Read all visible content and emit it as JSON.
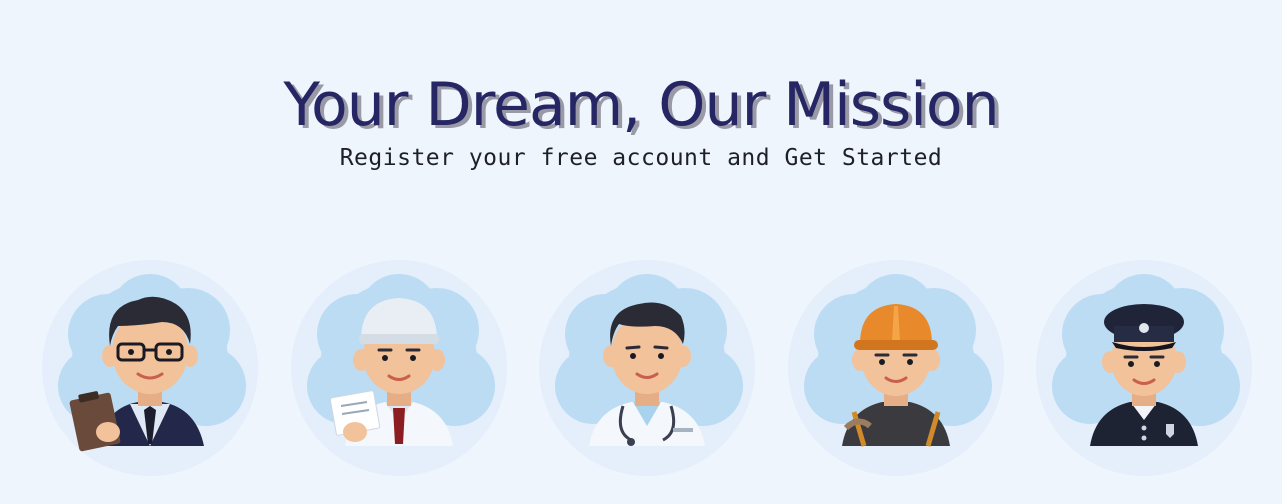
{
  "hero": {
    "title": "Your Dream, Our Mission",
    "subtitle": "Register your free account and Get Started"
  },
  "avatars": [
    {
      "name": "businessman-avatar",
      "icon": "businessman-icon"
    },
    {
      "name": "scientist-avatar",
      "icon": "scientist-icon"
    },
    {
      "name": "doctor-avatar",
      "icon": "doctor-icon"
    },
    {
      "name": "construction-worker-avatar",
      "icon": "construction-worker-icon"
    },
    {
      "name": "police-officer-avatar",
      "icon": "police-officer-icon"
    }
  ],
  "colors": {
    "background": "#eef5fd",
    "title": "#252663",
    "title_shadow": "#9a9aa6",
    "cloud": "#bcdcf3",
    "halo": "#e4effb",
    "skin": "#f2c29b",
    "hair": "#2b2b36"
  }
}
